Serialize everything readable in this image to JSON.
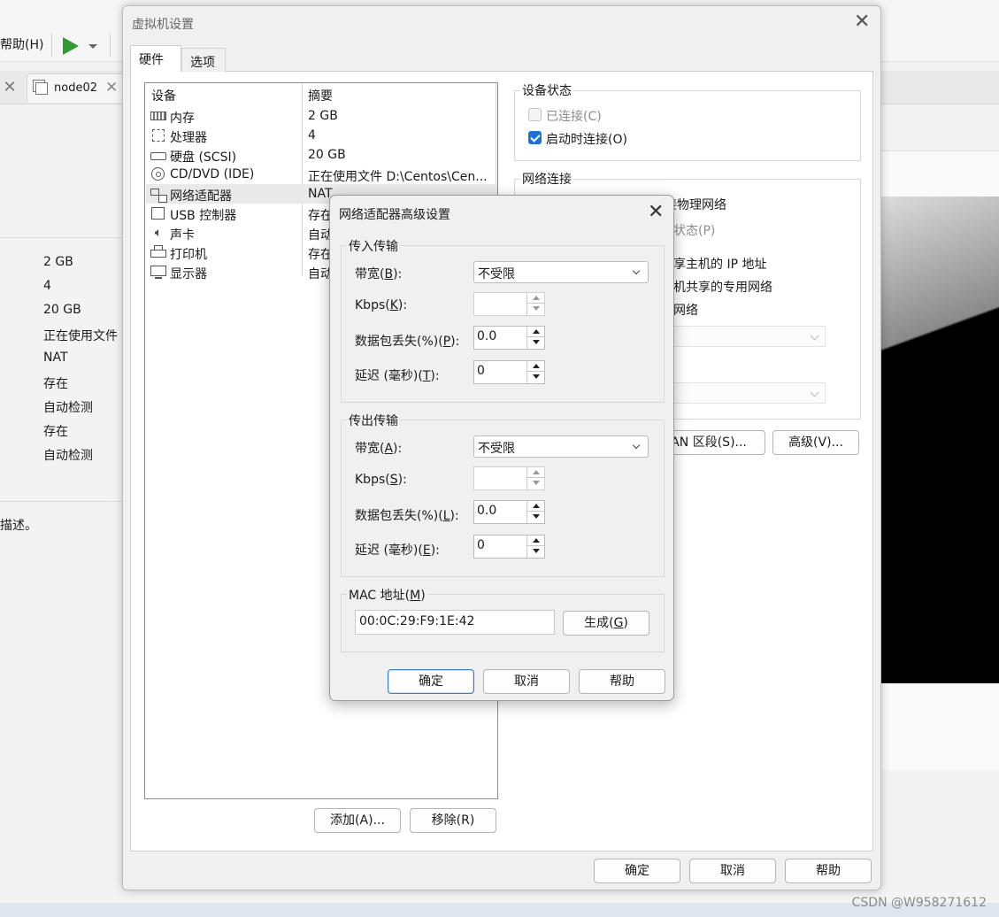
{
  "background": {
    "help_menu": "帮助(H)",
    "tab_node02": "node02",
    "summary_values": [
      "2 GB",
      "4",
      "20 GB",
      "正在使用文件",
      "NAT",
      "存在",
      "自动检测",
      "存在",
      "自动检测"
    ],
    "description_text": "描述。",
    "watermark": "CSDN @W958271612"
  },
  "vm_settings": {
    "title": "虚拟机设置",
    "tabs": [
      {
        "label": "硬件"
      },
      {
        "label": "选项"
      }
    ],
    "list_headers": {
      "device": "设备",
      "summary": "摘要"
    },
    "devices": [
      {
        "name": "内存",
        "summary": "2 GB",
        "icon": "memory-icon"
      },
      {
        "name": "处理器",
        "summary": "4",
        "icon": "cpu-icon"
      },
      {
        "name": "硬盘 (SCSI)",
        "summary": "20 GB",
        "icon": "harddisk-icon"
      },
      {
        "name": "CD/DVD (IDE)",
        "summary": "正在使用文件 D:\\Centos\\Cen...",
        "icon": "cd-icon"
      },
      {
        "name": "网络适配器",
        "summary": "NAT",
        "icon": "network-adapter-icon",
        "selected": true
      },
      {
        "name": "USB 控制器",
        "summary": "存在",
        "icon": "usb-icon"
      },
      {
        "name": "声卡",
        "summary": "自动",
        "icon": "sound-icon"
      },
      {
        "name": "打印机",
        "summary": "存在",
        "icon": "printer-icon"
      },
      {
        "name": "显示器",
        "summary": "自动",
        "icon": "monitor-icon"
      }
    ],
    "add_button": "添加(A)...",
    "remove_button": "移除(R)",
    "device_status": {
      "title": "设备状态",
      "connected": "已连接(C)",
      "connect_on_start": "启动时连接(O)"
    },
    "network_connection": {
      "title": "网络连接",
      "partial_lines": [
        "接物理网络",
        "状态(P)",
        "享主机的 IP 地址",
        "机共享的专用网络",
        "网络"
      ]
    },
    "lan_segments_button": "LAN 区段(S)...",
    "advanced_button": "高级(V)...",
    "ok_button": "确定",
    "cancel_button": "取消",
    "help_button": "帮助"
  },
  "advanced_dialog": {
    "title": "网络适配器高级设置",
    "incoming": {
      "title": "传入传输",
      "bandwidth_label": "带宽(",
      "bandwidth_key": "B",
      "bandwidth_value": "不受限",
      "kbps_label": "Kbps(",
      "kbps_key": "K",
      "kbps_value": "",
      "packet_loss_label": "数据包丢失(%)(",
      "packet_loss_key": "P",
      "packet_loss_value": "0.0",
      "latency_label": "延迟 (毫秒)(",
      "latency_key": "T",
      "latency_value": "0"
    },
    "outgoing": {
      "title": "传出传输",
      "bandwidth_label": "带宽(",
      "bandwidth_key": "A",
      "bandwidth_value": "不受限",
      "kbps_label": "Kbps(",
      "kbps_key": "S",
      "kbps_value": "",
      "packet_loss_label": "数据包丢失(%)(",
      "packet_loss_key": "L",
      "packet_loss_value": "0.0",
      "latency_label": "延迟 (毫秒)(",
      "latency_key": "E",
      "latency_value": "0"
    },
    "mac": {
      "title": "MAC 地址(",
      "title_key": "M",
      "value": "00:0C:29:F9:1E:42",
      "generate_label": "生成(",
      "generate_key": "G"
    },
    "label_suffix": "):",
    "paren_close": ")",
    "ok_button": "确定",
    "cancel_button": "取消",
    "help_button": "帮助"
  },
  "colors": {
    "checkbox_accent": "#1f6fd6",
    "play_green": "#2e9c2e"
  }
}
